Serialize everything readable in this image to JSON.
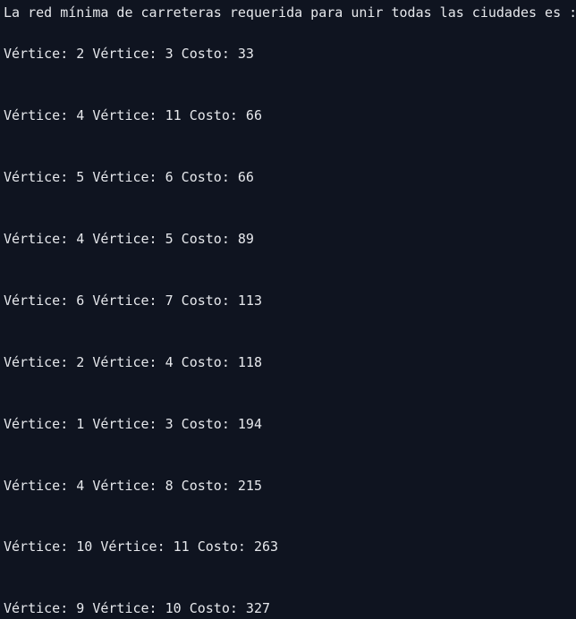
{
  "terminal": {
    "header": "La red mínima de carreteras requerida para unir todas las ciudades es :",
    "lines": [
      "Vértice: 2 Vértice: 3 Costo: 33",
      "Vértice: 4 Vértice: 11 Costo: 66",
      "Vértice: 5 Vértice: 6 Costo: 66",
      "Vértice: 4 Vértice: 5 Costo: 89",
      "Vértice: 6 Vértice: 7 Costo: 113",
      "Vértice: 2 Vértice: 4 Costo: 118",
      "Vértice: 1 Vértice: 3 Costo: 194",
      "Vértice: 4 Vértice: 8 Costo: 215",
      "Vértice: 10 Vértice: 11 Costo: 263",
      "Vértice: 9 Vértice: 10 Costo: 327"
    ]
  }
}
